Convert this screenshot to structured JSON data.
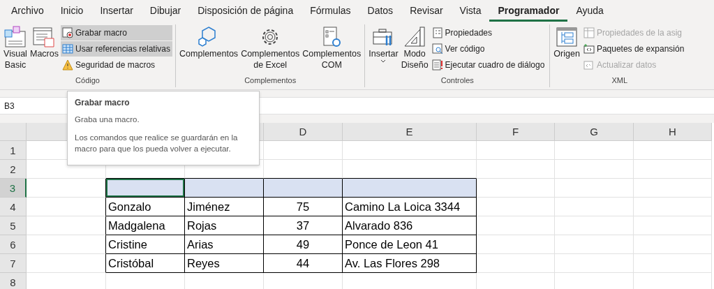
{
  "menu_tabs": [
    {
      "label": "Archivo",
      "selected": false
    },
    {
      "label": "Inicio",
      "selected": false
    },
    {
      "label": "Insertar",
      "selected": false
    },
    {
      "label": "Dibujar",
      "selected": false
    },
    {
      "label": "Disposición de página",
      "selected": false
    },
    {
      "label": "Fórmulas",
      "selected": false
    },
    {
      "label": "Datos",
      "selected": false
    },
    {
      "label": "Revisar",
      "selected": false
    },
    {
      "label": "Vista",
      "selected": false
    },
    {
      "label": "Programador",
      "selected": true
    },
    {
      "label": "Ayuda",
      "selected": false
    }
  ],
  "ribbon_groups": [
    {
      "label": "Código",
      "items": [
        {
          "kind": "large",
          "lines": [
            "Visual",
            "Basic"
          ]
        },
        {
          "kind": "large",
          "lines": [
            "Macros"
          ]
        },
        {
          "kind": "stack",
          "items": [
            {
              "label": "Grabar macro",
              "highlighted": true,
              "disabled": false
            },
            {
              "label": "Usar referencias relativas",
              "highlighted": true,
              "disabled": false
            },
            {
              "label": "Seguridad de macros",
              "highlighted": false,
              "disabled": false
            }
          ]
        }
      ]
    },
    {
      "label": "Complementos",
      "items": [
        {
          "kind": "large",
          "lines": [
            "Complementos"
          ]
        },
        {
          "kind": "large",
          "lines": [
            "Complementos",
            "de Excel"
          ]
        },
        {
          "kind": "large",
          "lines": [
            "Complementos",
            "COM"
          ]
        }
      ]
    },
    {
      "label": "Controles",
      "items": [
        {
          "kind": "large",
          "lines": [
            "Insertar"
          ],
          "dropdown": true
        },
        {
          "kind": "large",
          "lines": [
            "Modo",
            "Diseño"
          ]
        },
        {
          "kind": "stack",
          "items": [
            {
              "label": "Propiedades",
              "highlighted": false,
              "disabled": false
            },
            {
              "label": "Ver código",
              "highlighted": false,
              "disabled": false
            },
            {
              "label": "Ejecutar cuadro de diálogo",
              "highlighted": false,
              "disabled": false
            }
          ]
        }
      ]
    },
    {
      "label": "XML",
      "items": [
        {
          "kind": "large",
          "lines": [
            "Origen"
          ]
        },
        {
          "kind": "stack",
          "items": [
            {
              "label": "Propiedades de la asig",
              "highlighted": false,
              "disabled": true
            },
            {
              "label": "Paquetes de expansión",
              "highlighted": false,
              "disabled": false
            },
            {
              "label": "Actualizar datos",
              "highlighted": false,
              "disabled": true
            }
          ]
        }
      ]
    }
  ],
  "name_box": "B3",
  "tooltip": {
    "title": "Grabar macro",
    "lines": [
      "Graba una macro.",
      "Los comandos que realice se guardarán en la macro para que los pueda volver a ejecutar."
    ]
  },
  "columns": [
    {},
    {},
    {},
    {
      "label": "D"
    },
    {
      "label": "E"
    },
    {
      "label": "F"
    },
    {
      "label": "G"
    },
    {
      "label": "H"
    }
  ],
  "row_headers": [
    {
      "label": "1",
      "selected": false
    },
    {
      "label": "2",
      "selected": false
    },
    {
      "label": "3",
      "selected": true
    },
    {
      "label": "4",
      "selected": false
    },
    {
      "label": "5",
      "selected": false
    },
    {
      "label": "6",
      "selected": false
    },
    {
      "label": "7",
      "selected": false
    },
    {
      "label": "8",
      "selected": false
    }
  ],
  "table": {
    "header_cells": [
      {
        "selected": true
      },
      {
        "selected": false
      },
      {
        "selected": false
      },
      {
        "selected": false
      }
    ],
    "rows": [
      [
        "Gonzalo",
        "Jiménez",
        "75",
        "Camino La Loica 3344"
      ],
      [
        "Madgalena",
        "Rojas",
        "37",
        "Alvarado 836"
      ],
      [
        "Cristine",
        "Arias",
        "49",
        "Ponce de Leon 41"
      ],
      [
        "Cristóbal",
        "Reyes",
        "44",
        "Av. Las Flores 298"
      ]
    ]
  }
}
